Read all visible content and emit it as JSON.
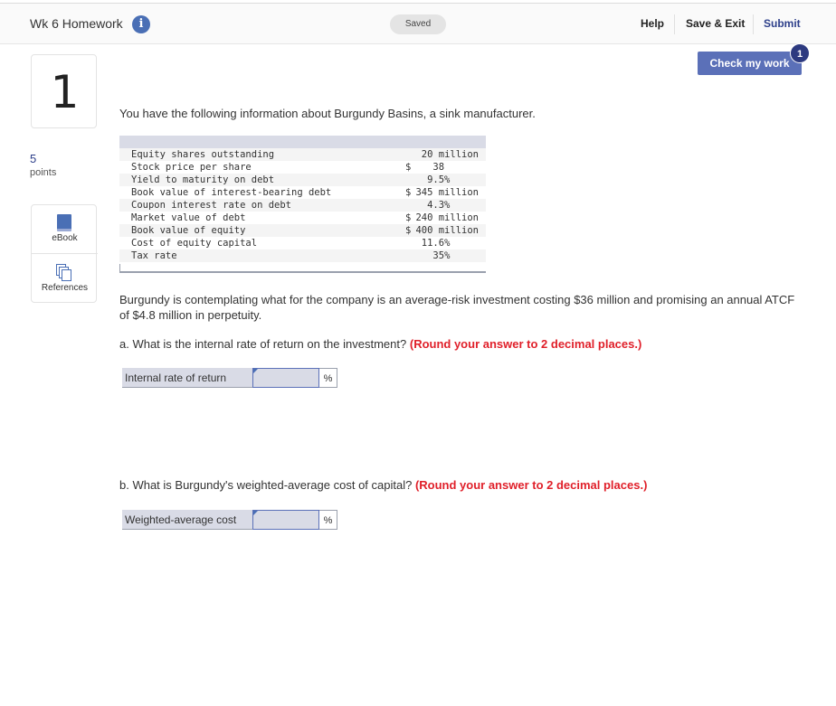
{
  "header": {
    "title": "Wk 6 Homework",
    "info_icon": "info-icon",
    "saved_status": "Saved",
    "nav": {
      "help": "Help",
      "save_exit": "Save & Exit",
      "submit": "Submit"
    }
  },
  "check_work": {
    "label": "Check my work",
    "badge_count": "1"
  },
  "question": {
    "number": "1",
    "points_value": "5",
    "points_label": "points"
  },
  "tools": [
    {
      "label": "eBook",
      "icon": "book-icon"
    },
    {
      "label": "References",
      "icon": "copy-icon"
    }
  ],
  "intro": "You have the following information about Burgundy Basins, a sink manufacturer.",
  "table": {
    "rows": [
      {
        "label": "Equity shares outstanding",
        "currency": "",
        "value": "20 million"
      },
      {
        "label": "Stock price per share",
        "currency": "$",
        "value": "38      "
      },
      {
        "label": "Yield to maturity on debt",
        "currency": "",
        "value": "9.5%     "
      },
      {
        "label": "Book value of interest-bearing debt",
        "currency": "$",
        "value": "345 million"
      },
      {
        "label": "Coupon interest rate on debt",
        "currency": "",
        "value": "4.3%     "
      },
      {
        "label": "Market value of debt",
        "currency": "$",
        "value": "240 million"
      },
      {
        "label": "Book value of equity",
        "currency": "$",
        "value": "400 million"
      },
      {
        "label": "Cost of equity capital",
        "currency": "",
        "value": "11.6%     "
      },
      {
        "label": "Tax rate",
        "currency": "",
        "value": "35%     "
      }
    ]
  },
  "scenario": "Burgundy is contemplating what for the company is an average-risk investment costing $36 million and promising an annual ATCF of $4.8 million in perpetuity.",
  "parts": [
    {
      "question": "a. What is the internal rate of return on the investment?",
      "hint": "(Round your answer to 2 decimal places.)",
      "field_label": "Internal rate of return",
      "value": "",
      "unit": "%"
    },
    {
      "question": "b. What is Burgundy's weighted-average cost of capital?",
      "hint": "(Round your answer to 2 decimal places.)",
      "field_label": "Weighted-average cost",
      "value": "",
      "unit": "%"
    }
  ]
}
